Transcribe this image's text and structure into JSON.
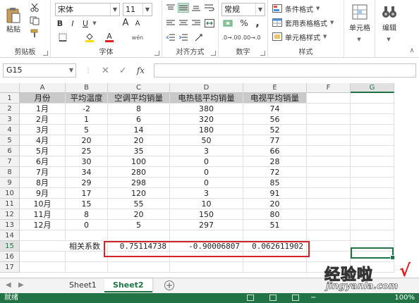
{
  "ribbon": {
    "clipboard": {
      "label": "剪贴板",
      "paste_label": "粘贴"
    },
    "font": {
      "label": "字体",
      "font_name": "宋体",
      "font_size": "11",
      "bold": "B",
      "italic": "I",
      "underline": "U",
      "grow": "A",
      "shrink": "A",
      "wen": "wén",
      "fill_letter": "A"
    },
    "alignment": {
      "label": "对齐方式"
    },
    "number": {
      "label": "数字",
      "format": "常规",
      "percent": "%",
      "comma": ","
    },
    "styles": {
      "label": "样式",
      "conditional": "条件格式",
      "table_format": "套用表格格式",
      "cell_styles": "单元格样式"
    },
    "cells": {
      "label": "单元格"
    },
    "editing": {
      "label": "编辑"
    }
  },
  "formula_bar": {
    "name_box": "G15",
    "fx": "fx",
    "formula": ""
  },
  "columns": [
    "A",
    "B",
    "C",
    "D",
    "E",
    "F",
    "G"
  ],
  "row_numbers": [
    "1",
    "2",
    "3",
    "4",
    "5",
    "6",
    "7",
    "8",
    "9",
    "10",
    "11",
    "12",
    "13",
    "14",
    "15",
    "16",
    "17"
  ],
  "table": {
    "headers": [
      "月份",
      "平均温度",
      "空调平均销量",
      "电热毯平均销量",
      "电视平均销量"
    ],
    "rows": [
      [
        "1月",
        "-2",
        "8",
        "380",
        "74"
      ],
      [
        "2月",
        "1",
        "6",
        "320",
        "56"
      ],
      [
        "3月",
        "5",
        "14",
        "180",
        "52"
      ],
      [
        "4月",
        "20",
        "20",
        "50",
        "77"
      ],
      [
        "5月",
        "25",
        "35",
        "3",
        "66"
      ],
      [
        "6月",
        "30",
        "100",
        "0",
        "28"
      ],
      [
        "7月",
        "34",
        "280",
        "0",
        "72"
      ],
      [
        "8月",
        "29",
        "298",
        "0",
        "85"
      ],
      [
        "9月",
        "17",
        "120",
        "3",
        "91"
      ],
      [
        "10月",
        "15",
        "55",
        "10",
        "20"
      ],
      [
        "11月",
        "8",
        "20",
        "150",
        "80"
      ],
      [
        "12月",
        "0",
        "5",
        "297",
        "51"
      ]
    ]
  },
  "correlation": {
    "label": "相关系数",
    "values": [
      "0.75114738",
      "-0.90006807",
      "0.062611902"
    ]
  },
  "sheets": {
    "tab1": "Sheet1",
    "tab2": "Sheet2",
    "active": "Sheet2"
  },
  "status": {
    "text": "就绪",
    "zoom": "100%"
  },
  "watermark": {
    "main": "经验啦",
    "sub": "jingyanla.com",
    "check": "√"
  },
  "colors": {
    "accent": "#217346",
    "highlight": "#d4222a",
    "header_fill": "#c9c9c9"
  }
}
